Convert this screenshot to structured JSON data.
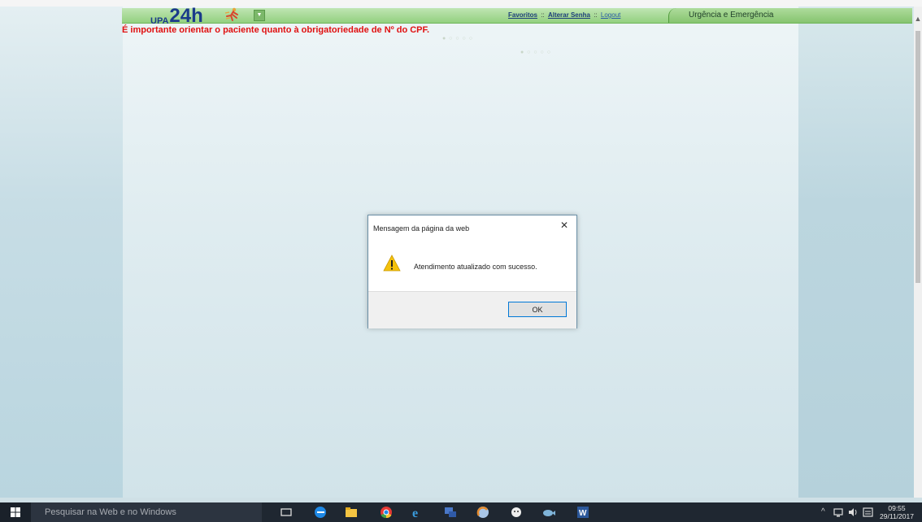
{
  "header": {
    "logo_prefix": "UPA",
    "logo_main": "24h",
    "links": {
      "favoritos": "Favoritos",
      "sep1": "::",
      "alterar_senha": "Alterar Senha",
      "sep2": "::",
      "logout": "Logout"
    },
    "module_tab": "Urgência e Emergência"
  },
  "main": {
    "warning": "É importante orientar o paciente quanto à obrigatoriedade de Nº do CPF.",
    "progress_dots_top": "● ○ ○ ○ ○",
    "progress_dots_center": "● ○ ○ ○ ○"
  },
  "dialog": {
    "title": "Mensagem da página da web",
    "message": "Atendimento atualizado com sucesso.",
    "ok_label": "OK",
    "close_glyph": "✕",
    "icon": "warning-icon"
  },
  "taskbar": {
    "search_placeholder": "Pesquisar na Web e no Windows",
    "tray_glyphs": "^",
    "time": "09:55",
    "date": "29/11/2017"
  },
  "colors": {
    "header_green": "#93d07f",
    "warning_red": "#e01010",
    "link_blue": "#1d3f7a",
    "taskbar": "#1f2731",
    "dialog_accent": "#0078d7"
  }
}
